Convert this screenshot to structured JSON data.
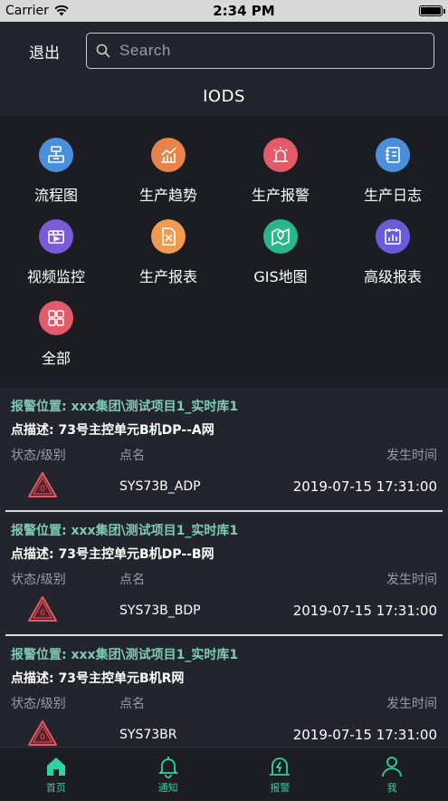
{
  "status_bar": {
    "carrier": "Carrier",
    "time": "2:34 PM"
  },
  "header": {
    "logout_label": "退出",
    "search_placeholder": "Search",
    "title": "IODS"
  },
  "grid": [
    {
      "label": "流程图",
      "icon": "flowchart-icon",
      "color": "#4a8fdc"
    },
    {
      "label": "生产趋势",
      "icon": "trend-chart-icon",
      "color": "#e8834a"
    },
    {
      "label": "生产报警",
      "icon": "alarm-siren-icon",
      "color": "#e35a68"
    },
    {
      "label": "生产日志",
      "icon": "log-book-icon",
      "color": "#4a8fdc"
    },
    {
      "label": "视频监控",
      "icon": "video-icon",
      "color": "#7b5bd8"
    },
    {
      "label": "生产报表",
      "icon": "report-icon",
      "color": "#f09a52"
    },
    {
      "label": "GIS地图",
      "icon": "map-pin-icon",
      "color": "#2bb58a"
    },
    {
      "label": "高级报表",
      "icon": "advanced-report-icon",
      "color": "#6a5bd8"
    },
    {
      "label": "全部",
      "icon": "all-apps-icon",
      "color": "#e35a68"
    }
  ],
  "alarm_columns": {
    "status": "状态/级别",
    "name": "点名",
    "time": "发生时间"
  },
  "alarms": [
    {
      "location": "报警位置: xxx集团\\测试项目1_实时库1",
      "description": "点描述: 73号主控单元B机DP--A网",
      "point_name": "SYS73B_ADP",
      "time": "2019-07-15 17:31:00",
      "level": "0"
    },
    {
      "location": "报警位置: xxx集团\\测试项目1_实时库1",
      "description": "点描述: 73号主控单元B机DP--B网",
      "point_name": "SYS73B_BDP",
      "time": "2019-07-15 17:31:00",
      "level": "0"
    },
    {
      "location": "报警位置: xxx集团\\测试项目1_实时库1",
      "description": "点描述: 73号主控单元B机R网",
      "point_name": "SYS73BR",
      "time": "2019-07-15 17:31:00",
      "level": "0"
    }
  ],
  "tabs": [
    {
      "label": "首页",
      "icon": "home-icon"
    },
    {
      "label": "通知",
      "icon": "bell-icon"
    },
    {
      "label": "报警",
      "icon": "alarm-bolt-icon"
    },
    {
      "label": "我",
      "icon": "user-icon"
    }
  ],
  "colors": {
    "accent": "#2fd3a0",
    "alarm_location": "#7fcbb2",
    "warning": "#e35a68"
  }
}
